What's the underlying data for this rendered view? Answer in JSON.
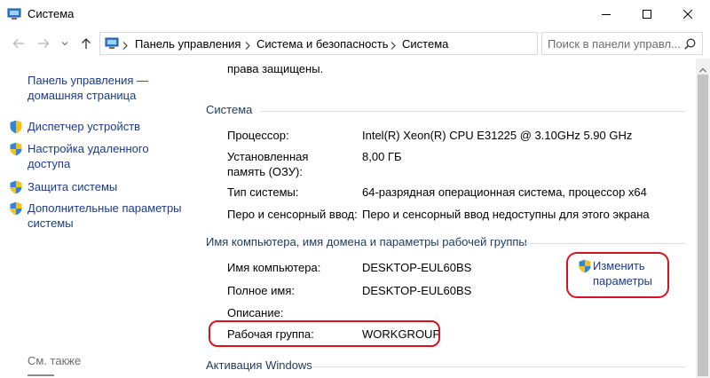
{
  "window": {
    "title": "Система"
  },
  "address_bar": {
    "crumbs": [
      "Панель управления",
      "Система и безопасность",
      "Система"
    ]
  },
  "search": {
    "placeholder": "Поиск в панели управл..."
  },
  "sidebar": {
    "home_link": "Панель управления — домашняя страница",
    "items": [
      {
        "label": "Диспетчер устройств"
      },
      {
        "label": "Настройка удаленного доступа"
      },
      {
        "label": "Защита системы"
      },
      {
        "label": "Дополнительные параметры системы"
      }
    ],
    "see_also": "См. также"
  },
  "main": {
    "rights_text": "права защищены.",
    "system_section": {
      "title": "Система",
      "rows": [
        {
          "label": "Процессор:",
          "value": "Intel(R) Xeon(R) CPU E31225 @ 3.10GHz   5.90 GHz"
        },
        {
          "label": "Установленная память (ОЗУ):",
          "value": "8,00 ГБ"
        },
        {
          "label": "Тип системы:",
          "value": "64-разрядная операционная система, процессор x64"
        },
        {
          "label": "Перо и сенсорный ввод:",
          "value": "Перо и сенсорный ввод недоступны для этого экрана"
        }
      ]
    },
    "computer_section": {
      "title": "Имя компьютера, имя домена и параметры рабочей группы",
      "rows": [
        {
          "label": "Имя компьютера:",
          "value": "DESKTOP-EUL60BS"
        },
        {
          "label": "Полное имя:",
          "value": "DESKTOP-EUL60BS"
        },
        {
          "label": "Описание:",
          "value": ""
        },
        {
          "label": "Рабочая группа:",
          "value": "WORKGROUP"
        }
      ],
      "change_link": "Изменить параметры"
    },
    "activation_section": {
      "title": "Активация Windows"
    }
  },
  "colors": {
    "link": "#1a3a8b",
    "section_title": "#1e395b",
    "highlight": "#d8121c"
  }
}
